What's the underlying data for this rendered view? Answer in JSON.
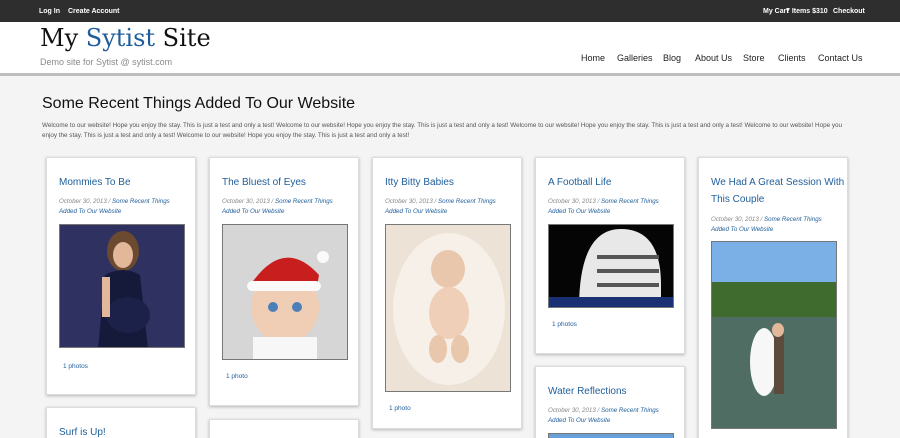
{
  "topbar": {
    "login": "Log In",
    "create_account": "Create Account",
    "my_cart": "My Cart",
    "cart_summary": "7 Items $310",
    "checkout": "Checkout"
  },
  "header": {
    "title_part1": "My ",
    "title_part2": "Sytist",
    "title_part3": " Site",
    "tagline": "Demo site for Sytist @ sytist.com",
    "nav": [
      "Home",
      "Galleries",
      "Blog",
      "About Us",
      "Store",
      "Clients",
      "Contact Us"
    ]
  },
  "main": {
    "heading": "Some Recent Things Added To Our Website",
    "intro": "Welcome to our website! Hope you enjoy the stay. This is just a test and only a test! Welcome to our website! Hope you enjoy the stay. This is just a test and only a test! Welcome to our website! Hope you enjoy the stay. This is just a test and only a test! Welcome to our website! Hope you enjoy the stay. This is just a test and only a test! Welcome to our website! Hope you enjoy the stay. This is just a test and only a test!"
  },
  "cards": [
    {
      "title": "Mommies To Be",
      "date": "October 30, 2013 /",
      "category": "Some Recent Things Added To Our Website",
      "photos": "1 photos"
    },
    {
      "title": "The Bluest of Eyes",
      "date": "October 30, 2013 /",
      "category": "Some Recent Things Added To Our Website",
      "photos": "1 photo"
    },
    {
      "title": "Itty Bitty Babies",
      "date": "October 30, 2013 /",
      "category": "Some Recent Things Added To Our Website",
      "photos": "1 photo"
    },
    {
      "title": "A Football Life",
      "date": "October 30, 2013 /",
      "category": "Some Recent Things Added To Our Website",
      "photos": "1 photos"
    },
    {
      "title": "We Had A Great Session With This Couple",
      "date": "October 30, 2013 /",
      "category": "Some Recent Things Added To Our Website",
      "photos": ""
    },
    {
      "title": "Water Reflections",
      "date": "October 30, 2013 /",
      "category": "Some Recent Things Added To Our Website",
      "photos": ""
    },
    {
      "title": "Surf is Up!",
      "date": "",
      "category": "",
      "photos": ""
    }
  ]
}
